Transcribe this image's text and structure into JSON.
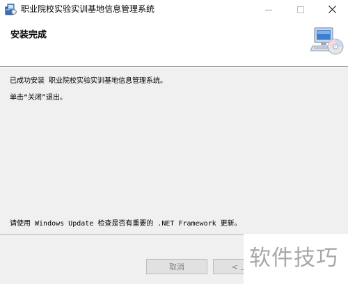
{
  "window": {
    "title": "职业院校实验实训基地信息管理系统",
    "app_icon": "installer-icon",
    "controls": {
      "minimize_icon": "minimize-icon",
      "maximize_icon": "maximize-icon",
      "close_icon": "close-icon"
    }
  },
  "header": {
    "title": "安装完成",
    "icon": "computer-cd-icon"
  },
  "content": {
    "line1": "已成功安装 职业院校实验实训基地信息管理系统。",
    "line2": "单击“关闭”退出。",
    "line3": "请使用 Windows Update 检查是否有重要的 .NET Framework 更新。"
  },
  "footer": {
    "cancel_label": "取消",
    "prev_label": "< 上一"
  },
  "watermark": {
    "text": "软件技巧"
  },
  "colors": {
    "content_bg": "#f0f0f0",
    "header_bg": "#ffffff",
    "disabled_text": "#838383",
    "watermark_text": "#a8a8a8"
  }
}
